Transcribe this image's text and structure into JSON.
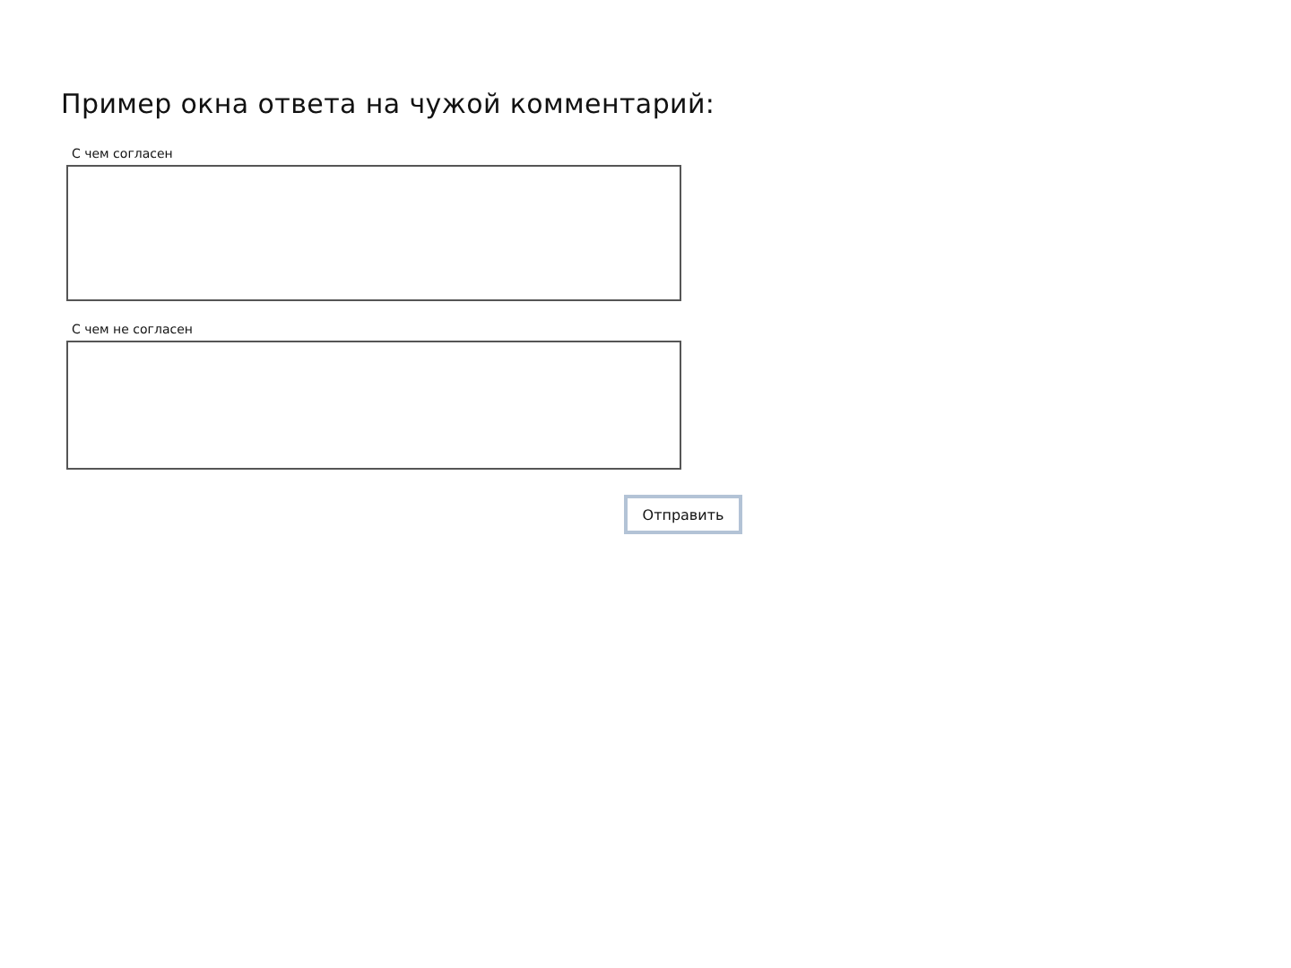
{
  "title": "Пример окна ответа на чужой комментарий:",
  "fields": [
    {
      "label": "С чем согласен"
    },
    {
      "label": "С чем не согласен"
    }
  ],
  "submit_button": "Отправить"
}
